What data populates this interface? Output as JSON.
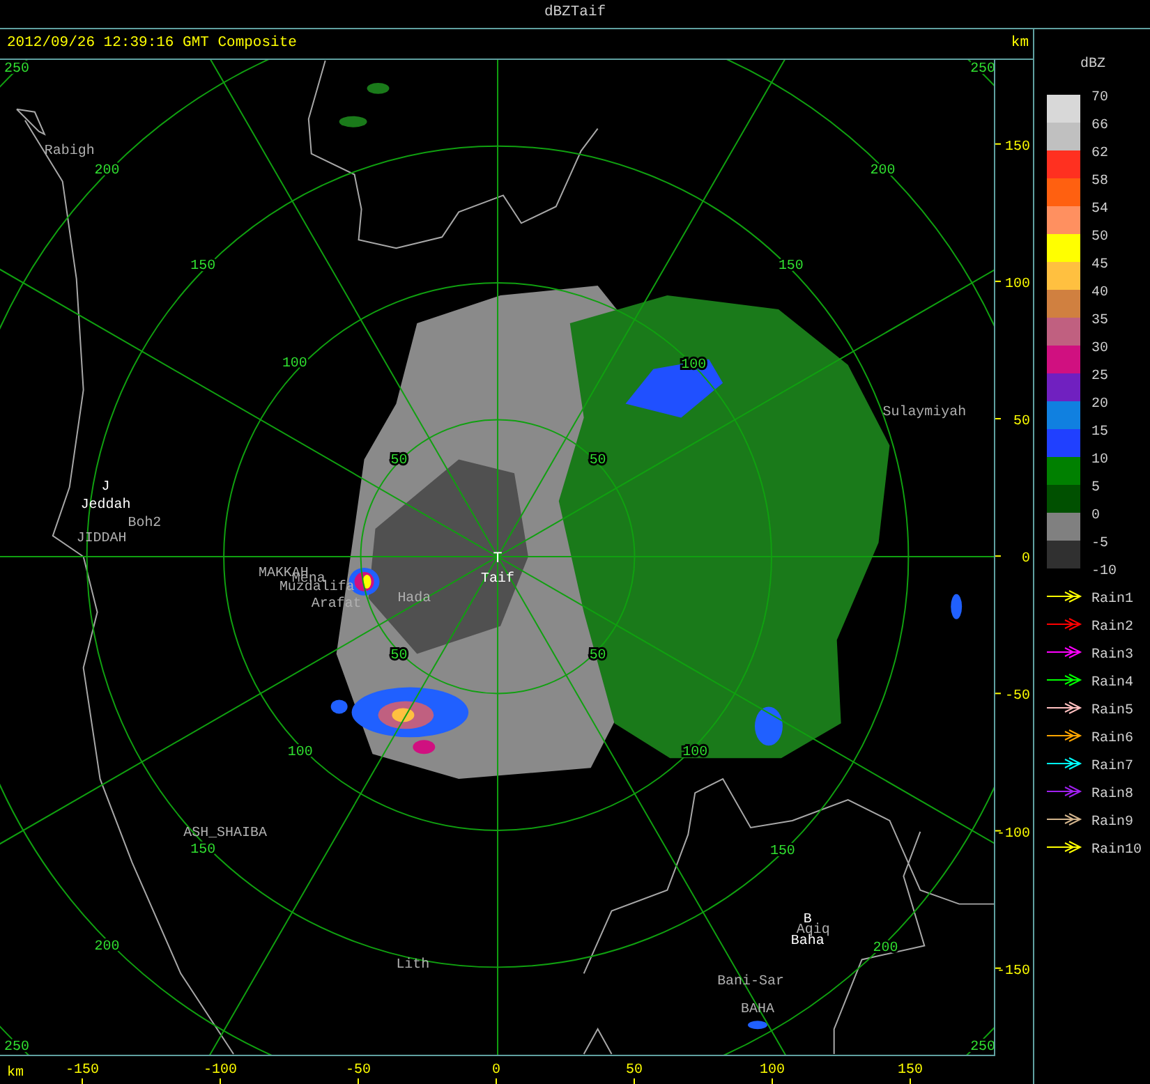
{
  "window": {
    "title": "dBZTaif"
  },
  "header": {
    "timestamp": "2012/09/26 12:39:16 GMT Composite",
    "unit": "km"
  },
  "map": {
    "site_marker": "T",
    "places": [
      {
        "name": "Rabigh",
        "kind": "minor"
      },
      {
        "name": "J",
        "kind": "major"
      },
      {
        "name": "Jeddah",
        "kind": "major"
      },
      {
        "name": "Boh2",
        "kind": "minor"
      },
      {
        "name": "JIDDAH",
        "kind": "minor"
      },
      {
        "name": "MAKKAH",
        "kind": "minor"
      },
      {
        "name": "Mena",
        "kind": "minor"
      },
      {
        "name": "Muzdalifa",
        "kind": "minor"
      },
      {
        "name": "Arafat",
        "kind": "minor"
      },
      {
        "name": "Hada",
        "kind": "minor"
      },
      {
        "name": "Taif",
        "kind": "major"
      },
      {
        "name": "Sulaymiyah",
        "kind": "minor"
      },
      {
        "name": "ASH_SHAIBA",
        "kind": "minor"
      },
      {
        "name": "Lith",
        "kind": "minor"
      },
      {
        "name": "B",
        "kind": "major"
      },
      {
        "name": "Aqiq",
        "kind": "minor"
      },
      {
        "name": "Baha",
        "kind": "major"
      },
      {
        "name": "Bani-Sar",
        "kind": "minor"
      },
      {
        "name": "BAHA",
        "kind": "minor"
      }
    ],
    "range_labels": [
      "200",
      "150",
      "100",
      "50",
      "50",
      "100",
      "150",
      "200",
      "50",
      "100",
      "150",
      "200",
      "50",
      "100",
      "150",
      "200",
      "250",
      "250",
      "250",
      "250"
    ]
  },
  "y_axis": {
    "ticks": [
      "150",
      "100",
      "50",
      "0",
      "-50",
      "-100",
      "-150"
    ]
  },
  "x_axis": {
    "unit": "km",
    "ticks": [
      "-150",
      "-100",
      "-50",
      "0",
      "50",
      "100",
      "150"
    ]
  },
  "legend": {
    "title": "dBZ",
    "bins": [
      {
        "color": "#d8d8d8"
      },
      {
        "color": "#c0c0c0"
      },
      {
        "color": "#ff3020"
      },
      {
        "color": "#ff6010"
      },
      {
        "color": "#ff9060"
      },
      {
        "color": "#ffff00"
      },
      {
        "color": "#ffc040"
      },
      {
        "color": "#d08040"
      },
      {
        "color": "#c06080"
      },
      {
        "color": "#d01080"
      },
      {
        "color": "#7020c0"
      },
      {
        "color": "#1080e0"
      },
      {
        "color": "#2040ff"
      },
      {
        "color": "#008000"
      },
      {
        "color": "#005000"
      },
      {
        "color": "#808080"
      },
      {
        "color": "#303030"
      }
    ],
    "labels": [
      "70",
      "66",
      "62",
      "58",
      "54",
      "50",
      "45",
      "40",
      "35",
      "30",
      "25",
      "20",
      "15",
      "10",
      "5",
      "0",
      "-5",
      "-10"
    ]
  },
  "tracks": [
    {
      "label": "Rain1",
      "color": "#ffff00"
    },
    {
      "label": "Rain2",
      "color": "#ff0000"
    },
    {
      "label": "Rain3",
      "color": "#ff00ff"
    },
    {
      "label": "Rain4",
      "color": "#00ff00"
    },
    {
      "label": "Rain5",
      "color": "#ffc0c0"
    },
    {
      "label": "Rain6",
      "color": "#ffa500"
    },
    {
      "label": "Rain7",
      "color": "#00ffff"
    },
    {
      "label": "Rain8",
      "color": "#a020f0"
    },
    {
      "label": "Rain9",
      "color": "#d2b48c"
    },
    {
      "label": "Rain10",
      "color": "#ffff00"
    }
  ]
}
